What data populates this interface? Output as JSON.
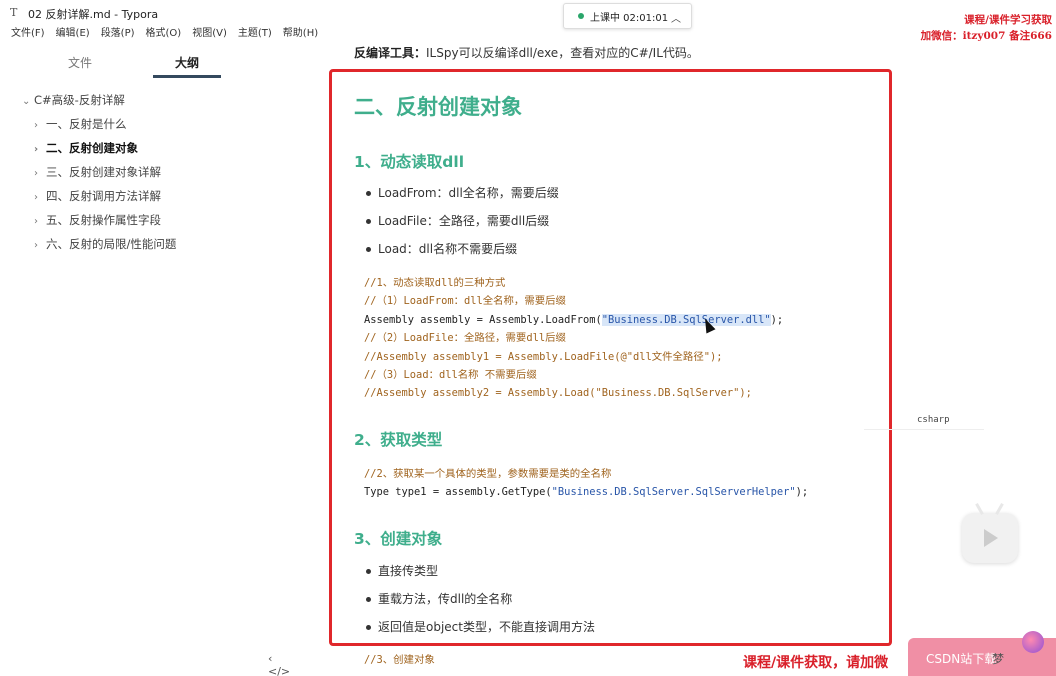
{
  "window": {
    "app_icon": "T",
    "title": "02 反射详解.md - Typora"
  },
  "menu": {
    "items": [
      "文件(F)",
      "编辑(E)",
      "段落(P)",
      "格式(O)",
      "视图(V)",
      "主题(T)",
      "帮助(H)"
    ]
  },
  "live": {
    "status": "上课中 02:01:01",
    "chevron_icon": "chevron-up-icon"
  },
  "watermark_top": {
    "line1": "课程/课件学习获取",
    "line2": "加微信：itzy007 备注666"
  },
  "sidebar": {
    "tabs": [
      "文件",
      "大纲"
    ],
    "active_tab": "大纲",
    "outline": [
      {
        "label": "C#高级-反射详解",
        "level": 0,
        "chevron": "⌄"
      },
      {
        "label": "一、反射是什么",
        "level": 1,
        "chevron": "›"
      },
      {
        "label": "二、反射创建对象",
        "level": 1,
        "chevron": "›",
        "active": true
      },
      {
        "label": "三、反射创建对象详解",
        "level": 1,
        "chevron": "›"
      },
      {
        "label": "四、反射调用方法详解",
        "level": 1,
        "chevron": "›"
      },
      {
        "label": "五、反射操作属性字段",
        "level": 1,
        "chevron": "›"
      },
      {
        "label": "六、反射的局限/性能问题",
        "level": 1,
        "chevron": "›"
      }
    ],
    "bottom_left": "‹",
    "bottom_code": "</>"
  },
  "doc": {
    "intro_bold": "反编译工具：",
    "intro_text": "ILSpy可以反编译dll/exe，查看对应的C#/IL代码。",
    "h2": "二、反射创建对象",
    "s1": {
      "title": "1、动态读取dll",
      "bullets": [
        "LoadFrom：dll全名称，需要后缀",
        "LoadFile：全路径，需要dll后缀",
        "Load：dll名称不需要后缀"
      ]
    },
    "code1": {
      "l1": "//1、动态读取dll的三种方式",
      "l2": "//（1）LoadFrom：dll全名称，需要后缀",
      "l3a": "Assembly assembly = Assembly.LoadFrom(",
      "l3s": "\"Business.DB.SqlServer.dll\"",
      "l3b": ");",
      "l4": "//（2）LoadFile：全路径，需要dll后缀",
      "l5": "//Assembly assembly1 = Assembly.LoadFile(@\"dll文件全路径\");",
      "l6": "//（3）Load：dll名称 不需要后缀",
      "l7": "//Assembly assembly2 = Assembly.Load(\"Business.DB.SqlServer\");"
    },
    "code_lang": "csharp",
    "s2": {
      "title": "2、获取类型"
    },
    "code2": {
      "l1": "//2、获取某一个具体的类型，参数需要是类的全名称",
      "l2a": "Type type1 = assembly.GetType(",
      "l2s": "\"Business.DB.SqlServer.SqlServerHelper\"",
      "l2b": ");"
    },
    "s3": {
      "title": "3、创建对象",
      "bullets": [
        "直接传类型",
        "重载方法，传dll的全名称",
        "返回值是object类型，不能直接调用方法"
      ]
    },
    "code3": {
      "l1": "//3、创建对象"
    }
  },
  "watermark_bottom": "课程/课件获取，请加微",
  "csdn": {
    "text": "CSDN站下载",
    "tail": "梦"
  }
}
